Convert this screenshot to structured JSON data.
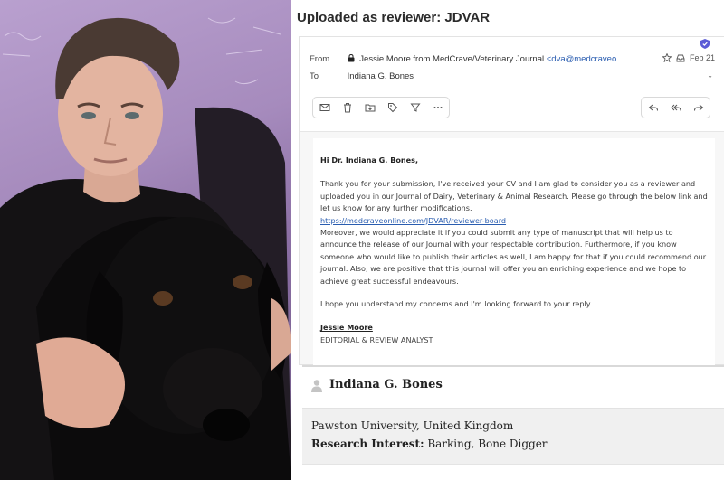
{
  "page_heading": "Uploaded as reviewer: JDVAR",
  "email": {
    "from_label": "From",
    "from_name": "Jessie Moore from MedCrave/Veterinary Journal",
    "from_email": "<dva@medcraveo...",
    "date": "Feb 21",
    "to_label": "To",
    "to_name": "Indiana G. Bones",
    "toolbar_icons": [
      "mail-icon",
      "trash-icon",
      "folder-icon",
      "tag-icon",
      "filter-icon",
      "more-icon"
    ],
    "action_icons": [
      "reply-icon",
      "reply-all-icon",
      "forward-icon"
    ],
    "body": {
      "greeting": "Hi Dr. Indiana G. Bones,",
      "para1": "Thank you for your submission, I've received your CV and I am glad to consider you as a reviewer and uploaded you in our Journal of Dairy, Veterinary & Animal Research. Please go through the below link and let us know for any further modifications.",
      "link": "https://medcraveonline.com/JDVAR/reviewer-board",
      "para2": "Moreover, we would appreciate it if you could submit any type of manuscript that will help us to announce the release of our Journal with your respectable contribution. Furthermore, if you know someone who would like to publish their articles as well, I am happy for that if you could recommend our journal. Also, we are positive that this journal will offer you an enriching experience and we hope to achieve great successful endeavours.",
      "para3": "I hope you understand my concerns and I'm looking forward to your reply.",
      "signature_name": "Jessie Moore",
      "signature_title": "EDITORIAL & REVIEW ANALYST"
    }
  },
  "profile": {
    "name": "Indiana G. Bones",
    "affiliation": "Pawston University, United Kingdom",
    "research_label": "Research Interest:",
    "research_value": " Barking, Bone Digger"
  },
  "colors": {
    "link": "#2a5db0",
    "verified_badge": "#5b5bd6"
  }
}
